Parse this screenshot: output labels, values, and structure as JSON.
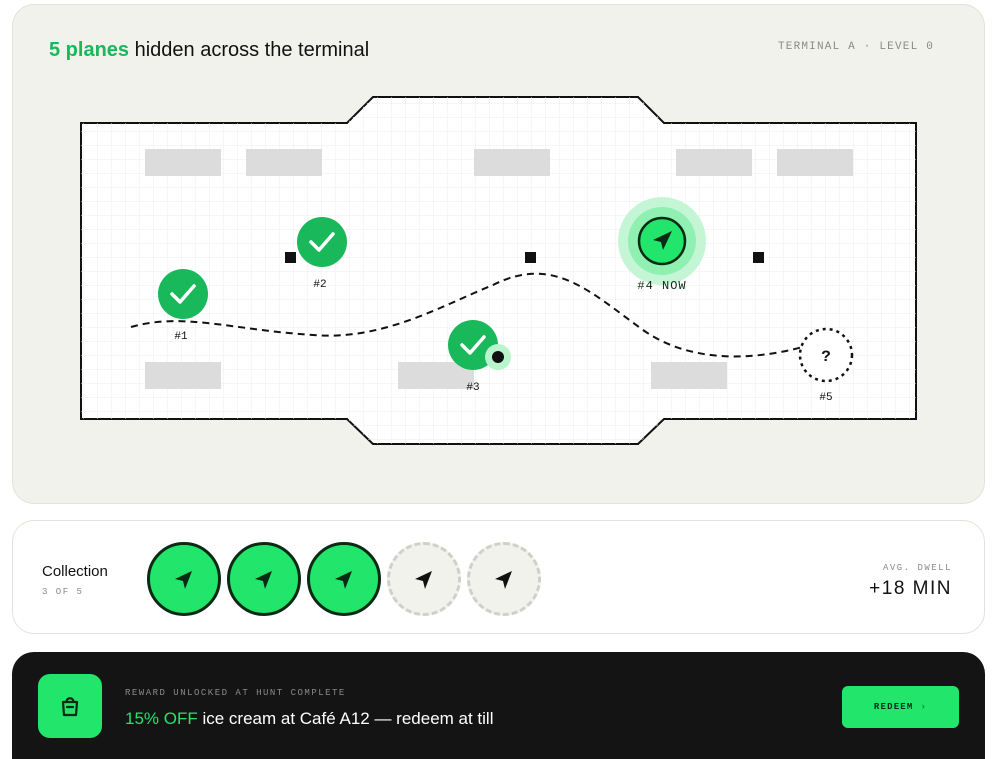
{
  "map": {
    "headline_accent": "5 planes",
    "headline_rest": " hidden across the terminal",
    "terminal_label": "TERMINAL A · LEVEL 0",
    "planes": [
      {
        "label": "#1",
        "status": "found"
      },
      {
        "label": "#2",
        "status": "found"
      },
      {
        "label": "#3",
        "status": "found"
      },
      {
        "label": "#4 NOW",
        "status": "current"
      },
      {
        "label": "#5",
        "status": "unknown",
        "mark": "?"
      }
    ]
  },
  "collection": {
    "title": "Collection",
    "count": "3 OF 5",
    "badges": [
      "found",
      "found",
      "found",
      "missing",
      "missing"
    ],
    "dwell_label": "AVG. DWELL",
    "dwell_value": "+18 MIN"
  },
  "reward": {
    "eyebrow": "REWARD UNLOCKED AT HUNT COMPLETE",
    "highlight": "15% OFF",
    "text": " ice cream at Café A12 — redeem at till",
    "button_label": "REDEEM",
    "button_chevron": "›",
    "icon": "shopping-bag-icon"
  },
  "colors": {
    "accent": "#22e56b",
    "accent_dark": "#19b85a",
    "dark": "#141414",
    "panel": "#f2f2ec"
  }
}
